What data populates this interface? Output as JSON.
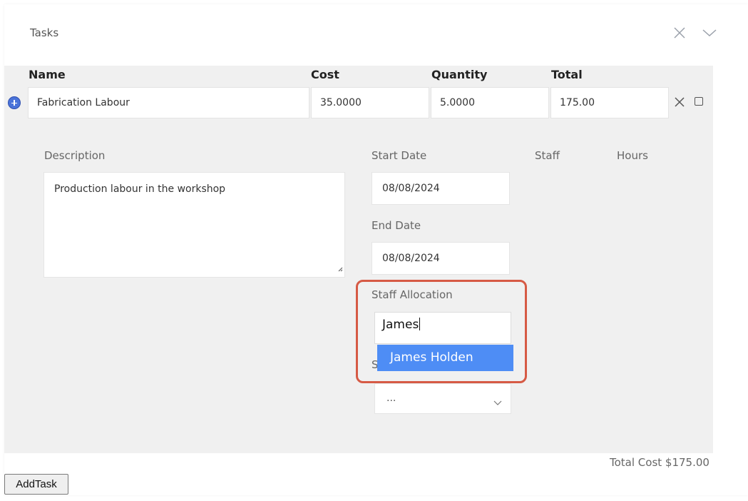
{
  "header": {
    "title": "Tasks",
    "close_icon": "close-icon",
    "collapse_icon": "chevron-down-icon"
  },
  "table": {
    "columns": [
      "Name",
      "Cost",
      "Quantity",
      "Total"
    ],
    "row": {
      "name": "Fabrication Labour",
      "cost": "35.0000",
      "quantity": "5.0000",
      "total": "175.00"
    }
  },
  "detail": {
    "description_label": "Description",
    "description_value": "Production labour in the workshop",
    "start_date_label": "Start Date",
    "start_date_value": "08/08/2024",
    "end_date_label": "End Date",
    "end_date_value": "08/08/2024",
    "staff_label": "Staff",
    "hours_label": "Hours",
    "staff_allocation_label": "Staff Allocation",
    "staff_allocation_value": "James",
    "suggestion": "James Holden",
    "hidden_label_fragment": "S",
    "select_value": "..."
  },
  "footer": {
    "total_cost": "Total Cost $175.00",
    "add_task_label": "AddTask"
  },
  "colors": {
    "accent_blue": "#4e8df5",
    "highlight_red": "#d65a45",
    "panel_gray": "#f0f0f0"
  }
}
